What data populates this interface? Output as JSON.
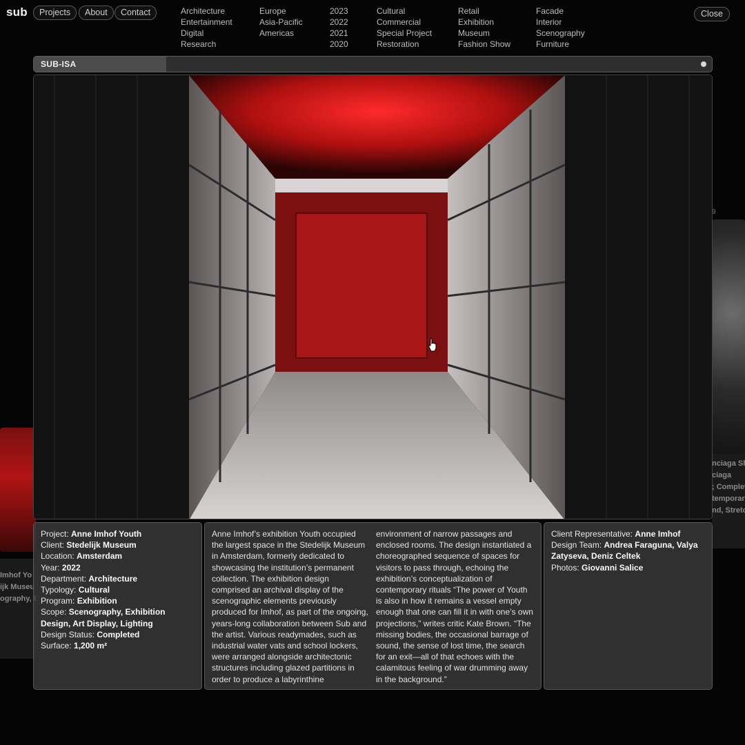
{
  "nav": {
    "logo": "sub",
    "links": [
      "Projects",
      "About",
      "Contact"
    ],
    "close": "Close"
  },
  "filters": [
    [
      "Architecture",
      "Entertainment",
      "Digital",
      "Research"
    ],
    [
      "Europe",
      "Asia-Pacific",
      "Americas"
    ],
    [
      "2023",
      "2022",
      "2021",
      "2020"
    ],
    [
      "Cultural",
      "Commercial",
      "Special Project",
      "Restoration"
    ],
    [
      "Retail",
      "Exhibition",
      "Museum",
      "Fashion Show"
    ],
    [
      "Facade",
      "Interior",
      "Scenography",
      "Furniture"
    ]
  ],
  "viewer": {
    "title": "SUB-ISA",
    "progress_fraction": 0.195
  },
  "details": [
    {
      "label": "Project:",
      "value": "Anne Imhof Youth"
    },
    {
      "label": "Client:",
      "value": "Stedelijk Museum"
    },
    {
      "label": "Location:",
      "value": "Amsterdam"
    },
    {
      "label": "Year:",
      "value": "2022"
    },
    {
      "label": "Department:",
      "value": "Architecture"
    },
    {
      "label": "Typology:",
      "value": "Cultural"
    },
    {
      "label": "Program:",
      "value": "Exhibition"
    },
    {
      "label": "Scope:",
      "value": "Scenography, Exhibition Design, Art Display, Lighting"
    },
    {
      "label": "Design Status:",
      "value": "Completed"
    },
    {
      "label": "Surface:",
      "value": "1,200 m²"
    }
  ],
  "description": {
    "col1": "Anne Imhof’s exhibition Youth occupied the largest space in the Stedelijk Museum in Amsterdam, formerly dedicated to showcasing the institution’s permanent collection. The exhibition design comprised an archival display of the scenographic elements previously produced for Imhof, as part of the ongoing, years-long collaboration between Sub and the artist. Various readymades, such as industrial water vats and school lockers, were arranged alongside architectonic structures including glazed partitions in order to produce a labyrinthine",
    "col2": "environment of narrow passages and enclosed rooms. The design instantiated a choreographed sequence of spaces for visitors to pass through, echoing the exhibition’s conceptualization of contemporary rituals “The power of Youth is also in how it remains a vessel empty enough that one can fill it in with one’s own projections,” writes critic Kate Brown. “The missing bodies, the occasional barrage of sound, the sense of lost time, the search for an exit—all of that echoes with the calamitous feeling of war drumming away in the background.”"
  },
  "credits": [
    {
      "label": "Client Representative:",
      "value": "Anne Imhof"
    },
    {
      "label": "Design Team:",
      "value": "Andrea Faraguna, Valya Zatyseva, Deniz Celtek"
    },
    {
      "label": "Photos:",
      "value": "Giovanni Salice"
    }
  ],
  "background": {
    "left_lines": [
      "Imhof Yo",
      "ijk Museu",
      "ography, E"
    ],
    "right_lines": [
      "nciaga Sh",
      "ciaga",
      "; Complet",
      "temporary",
      "nd, Stretc"
    ],
    "right_number": "9"
  },
  "colors": {
    "background": "#050505",
    "panel": "#3c3c3c",
    "accent_red": "#d41414"
  }
}
